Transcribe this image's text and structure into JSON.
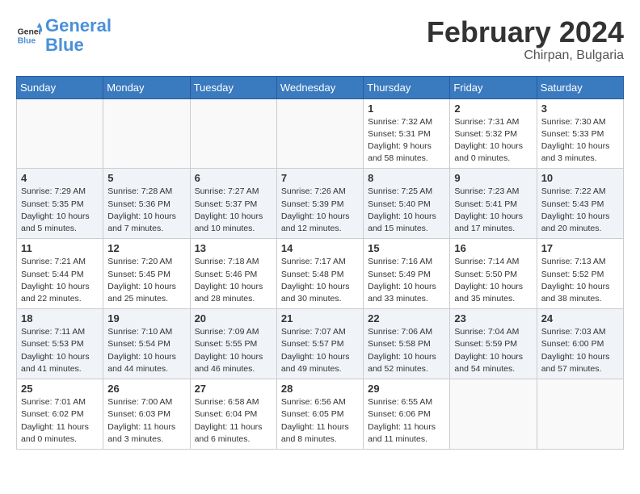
{
  "header": {
    "logo_general": "General",
    "logo_blue": "Blue",
    "month_year": "February 2024",
    "location": "Chirpan, Bulgaria"
  },
  "weekdays": [
    "Sunday",
    "Monday",
    "Tuesday",
    "Wednesday",
    "Thursday",
    "Friday",
    "Saturday"
  ],
  "weeks": [
    [
      {
        "day": "",
        "info": ""
      },
      {
        "day": "",
        "info": ""
      },
      {
        "day": "",
        "info": ""
      },
      {
        "day": "",
        "info": ""
      },
      {
        "day": "1",
        "info": "Sunrise: 7:32 AM\nSunset: 5:31 PM\nDaylight: 9 hours\nand 58 minutes."
      },
      {
        "day": "2",
        "info": "Sunrise: 7:31 AM\nSunset: 5:32 PM\nDaylight: 10 hours\nand 0 minutes."
      },
      {
        "day": "3",
        "info": "Sunrise: 7:30 AM\nSunset: 5:33 PM\nDaylight: 10 hours\nand 3 minutes."
      }
    ],
    [
      {
        "day": "4",
        "info": "Sunrise: 7:29 AM\nSunset: 5:35 PM\nDaylight: 10 hours\nand 5 minutes."
      },
      {
        "day": "5",
        "info": "Sunrise: 7:28 AM\nSunset: 5:36 PM\nDaylight: 10 hours\nand 7 minutes."
      },
      {
        "day": "6",
        "info": "Sunrise: 7:27 AM\nSunset: 5:37 PM\nDaylight: 10 hours\nand 10 minutes."
      },
      {
        "day": "7",
        "info": "Sunrise: 7:26 AM\nSunset: 5:39 PM\nDaylight: 10 hours\nand 12 minutes."
      },
      {
        "day": "8",
        "info": "Sunrise: 7:25 AM\nSunset: 5:40 PM\nDaylight: 10 hours\nand 15 minutes."
      },
      {
        "day": "9",
        "info": "Sunrise: 7:23 AM\nSunset: 5:41 PM\nDaylight: 10 hours\nand 17 minutes."
      },
      {
        "day": "10",
        "info": "Sunrise: 7:22 AM\nSunset: 5:43 PM\nDaylight: 10 hours\nand 20 minutes."
      }
    ],
    [
      {
        "day": "11",
        "info": "Sunrise: 7:21 AM\nSunset: 5:44 PM\nDaylight: 10 hours\nand 22 minutes."
      },
      {
        "day": "12",
        "info": "Sunrise: 7:20 AM\nSunset: 5:45 PM\nDaylight: 10 hours\nand 25 minutes."
      },
      {
        "day": "13",
        "info": "Sunrise: 7:18 AM\nSunset: 5:46 PM\nDaylight: 10 hours\nand 28 minutes."
      },
      {
        "day": "14",
        "info": "Sunrise: 7:17 AM\nSunset: 5:48 PM\nDaylight: 10 hours\nand 30 minutes."
      },
      {
        "day": "15",
        "info": "Sunrise: 7:16 AM\nSunset: 5:49 PM\nDaylight: 10 hours\nand 33 minutes."
      },
      {
        "day": "16",
        "info": "Sunrise: 7:14 AM\nSunset: 5:50 PM\nDaylight: 10 hours\nand 35 minutes."
      },
      {
        "day": "17",
        "info": "Sunrise: 7:13 AM\nSunset: 5:52 PM\nDaylight: 10 hours\nand 38 minutes."
      }
    ],
    [
      {
        "day": "18",
        "info": "Sunrise: 7:11 AM\nSunset: 5:53 PM\nDaylight: 10 hours\nand 41 minutes."
      },
      {
        "day": "19",
        "info": "Sunrise: 7:10 AM\nSunset: 5:54 PM\nDaylight: 10 hours\nand 44 minutes."
      },
      {
        "day": "20",
        "info": "Sunrise: 7:09 AM\nSunset: 5:55 PM\nDaylight: 10 hours\nand 46 minutes."
      },
      {
        "day": "21",
        "info": "Sunrise: 7:07 AM\nSunset: 5:57 PM\nDaylight: 10 hours\nand 49 minutes."
      },
      {
        "day": "22",
        "info": "Sunrise: 7:06 AM\nSunset: 5:58 PM\nDaylight: 10 hours\nand 52 minutes."
      },
      {
        "day": "23",
        "info": "Sunrise: 7:04 AM\nSunset: 5:59 PM\nDaylight: 10 hours\nand 54 minutes."
      },
      {
        "day": "24",
        "info": "Sunrise: 7:03 AM\nSunset: 6:00 PM\nDaylight: 10 hours\nand 57 minutes."
      }
    ],
    [
      {
        "day": "25",
        "info": "Sunrise: 7:01 AM\nSunset: 6:02 PM\nDaylight: 11 hours\nand 0 minutes."
      },
      {
        "day": "26",
        "info": "Sunrise: 7:00 AM\nSunset: 6:03 PM\nDaylight: 11 hours\nand 3 minutes."
      },
      {
        "day": "27",
        "info": "Sunrise: 6:58 AM\nSunset: 6:04 PM\nDaylight: 11 hours\nand 6 minutes."
      },
      {
        "day": "28",
        "info": "Sunrise: 6:56 AM\nSunset: 6:05 PM\nDaylight: 11 hours\nand 8 minutes."
      },
      {
        "day": "29",
        "info": "Sunrise: 6:55 AM\nSunset: 6:06 PM\nDaylight: 11 hours\nand 11 minutes."
      },
      {
        "day": "",
        "info": ""
      },
      {
        "day": "",
        "info": ""
      }
    ]
  ]
}
